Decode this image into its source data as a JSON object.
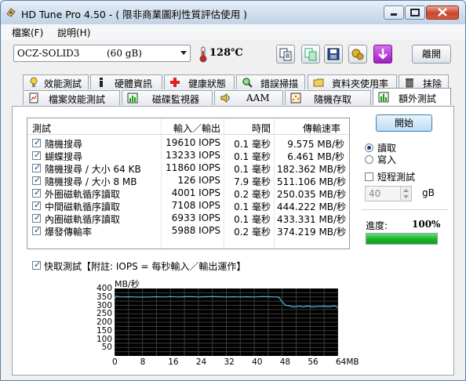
{
  "window": {
    "title": "HD Tune Pro 4.50 - ( 限非商業圖利性質評估使用 )"
  },
  "menu": [
    "檔案(F)",
    "說明(H)"
  ],
  "toolbar": {
    "drive_name": "OCZ-SOLID3",
    "drive_size": "(60 gB)",
    "temperature": "128℃",
    "exit_label": "離開",
    "icons": [
      "copy-text-icon",
      "copy-screenshot-icon",
      "save-icon",
      "options-icon",
      "download-icon"
    ]
  },
  "tabs_row1": [
    "效能測試",
    "硬體資訊",
    "健康狀態",
    "錯誤掃描",
    "資料夾使用率",
    "抹除"
  ],
  "tabs_row2": [
    "檔案效能測試",
    "磁碟監視器",
    "AAM",
    "隨機存取",
    "額外測試"
  ],
  "active_tab": "額外測試",
  "results": {
    "headers": [
      "測試",
      "輸入／輸出",
      "時間",
      "傳輸速率"
    ],
    "rows": [
      {
        "name": "隨機搜尋",
        "io": "19610 IOPS",
        "time": "0.1 毫秒",
        "rate": "9.575 MB/秒",
        "checked": true
      },
      {
        "name": "蝴蝶搜尋",
        "io": "13233 IOPS",
        "time": "0.1 毫秒",
        "rate": "6.461 MB/秒",
        "checked": true
      },
      {
        "name": "隨機搜尋 / 大小 64 KB",
        "io": "11860 IOPS",
        "time": "0.1 毫秒",
        "rate": "182.362 MB/秒",
        "checked": true
      },
      {
        "name": "隨機搜尋 / 大小 8 MB",
        "io": "126 IOPS",
        "time": "7.9 毫秒",
        "rate": "511.106 MB/秒",
        "checked": true
      },
      {
        "name": "外圈磁軌循序讀取",
        "io": "4001 IOPS",
        "time": "0.2 毫秒",
        "rate": "250.035 MB/秒",
        "checked": true
      },
      {
        "name": "中間磁軌循序讀取",
        "io": "7108 IOPS",
        "time": "0.1 毫秒",
        "rate": "444.222 MB/秒",
        "checked": true
      },
      {
        "name": "內圈磁軌循序讀取",
        "io": "6933 IOPS",
        "time": "0.1 毫秒",
        "rate": "433.331 MB/秒",
        "checked": true
      },
      {
        "name": "爆發傳輸率",
        "io": "5988 IOPS",
        "time": "0.2 毫秒",
        "rate": "374.219 MB/秒",
        "checked": true
      }
    ]
  },
  "side": {
    "start_label": "開始",
    "read_label": "讀取",
    "write_label": "寫入",
    "short_test_label": "短程測試",
    "short_test_value": "40",
    "short_test_unit": "gB",
    "progress_label": "進度:",
    "progress_value": "100%",
    "progress_fraction": 1.0
  },
  "quick_test": {
    "label": "快取測試【附註: IOPS = 每秒輸入／輸出運作】",
    "checked": true
  },
  "chart_data": {
    "type": "line",
    "ylabel": "MB/秒",
    "xlabel_unit": "MB",
    "ylim": [
      0,
      400
    ],
    "xlim": [
      0,
      64
    ],
    "yticks": [
      50,
      100,
      150,
      200,
      250,
      300,
      350,
      400
    ],
    "xticks": [
      "0",
      "8",
      "16",
      "24",
      "32",
      "40",
      "48",
      "56",
      "64MB"
    ],
    "grid": true,
    "series": [
      {
        "color": "#4fb3e6",
        "x": [
          0,
          0.5,
          1,
          2,
          4,
          6,
          8,
          10,
          12,
          14,
          16,
          18,
          20,
          22,
          24,
          26,
          28,
          30,
          32,
          34,
          36,
          38,
          40,
          42,
          44,
          46,
          47,
          48,
          49,
          50,
          51,
          52,
          53,
          54,
          55,
          56,
          57,
          58,
          59,
          60,
          61,
          62,
          63,
          64
        ],
        "y": [
          340,
          355,
          352,
          350,
          351,
          350,
          349,
          350,
          351,
          350,
          352,
          350,
          351,
          352,
          350,
          351,
          352,
          351,
          350,
          351,
          350,
          351,
          350,
          352,
          351,
          350,
          349,
          320,
          300,
          298,
          290,
          292,
          295,
          290,
          296,
          293,
          290,
          294,
          292,
          296,
          291,
          293,
          298,
          285
        ]
      }
    ]
  }
}
